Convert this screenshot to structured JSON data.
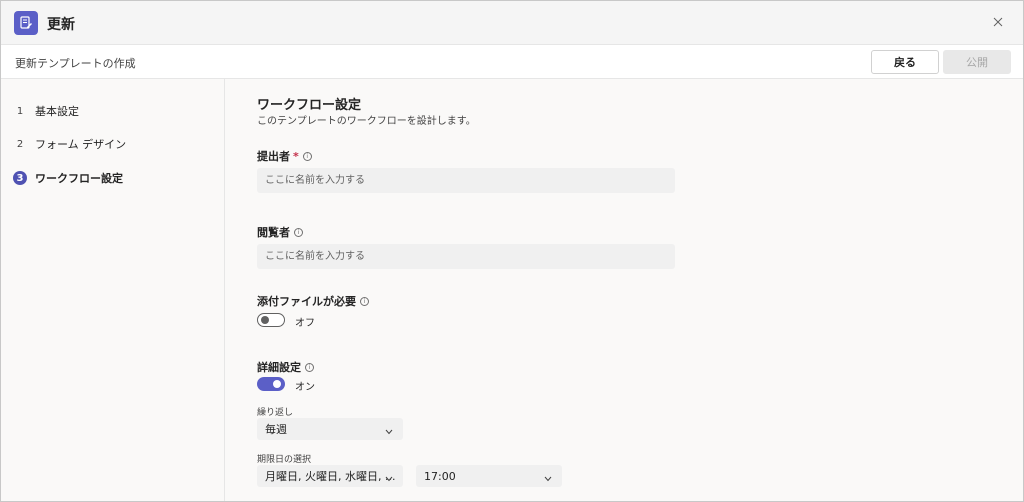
{
  "app": {
    "title": "更新"
  },
  "subheader": {
    "title": "更新テンプレートの作成",
    "back_label": "戻る",
    "publish_label": "公開"
  },
  "steps": [
    {
      "num": "1",
      "label": "基本設定"
    },
    {
      "num": "2",
      "label": "フォーム デザイン"
    },
    {
      "num": "3",
      "label": "ワークフロー設定"
    }
  ],
  "main": {
    "title": "ワークフロー設定",
    "description": "このテンプレートのワークフローを設計します。",
    "submitter": {
      "label": "提出者",
      "required_mark": "*",
      "placeholder": "ここに名前を入力する"
    },
    "viewer": {
      "label": "閲覧者",
      "placeholder": "ここに名前を入力する"
    },
    "attachment": {
      "label": "添付ファイルが必要",
      "state": "オフ"
    },
    "advanced": {
      "label": "詳細設定",
      "state": "オン"
    },
    "repeat": {
      "label": "繰り返し",
      "value": "毎週"
    },
    "due_date": {
      "label": "期限日の選択",
      "days_value": "月曜日, 火曜日, 水曜日, ...",
      "time_value": "17:00"
    }
  },
  "icons": {
    "app": "form-edit-icon",
    "close": "close-icon",
    "info": "info-icon",
    "chevron": "chevron-down-icon"
  },
  "colors": {
    "accent": "#5b5fc7",
    "required": "#c4314b"
  }
}
